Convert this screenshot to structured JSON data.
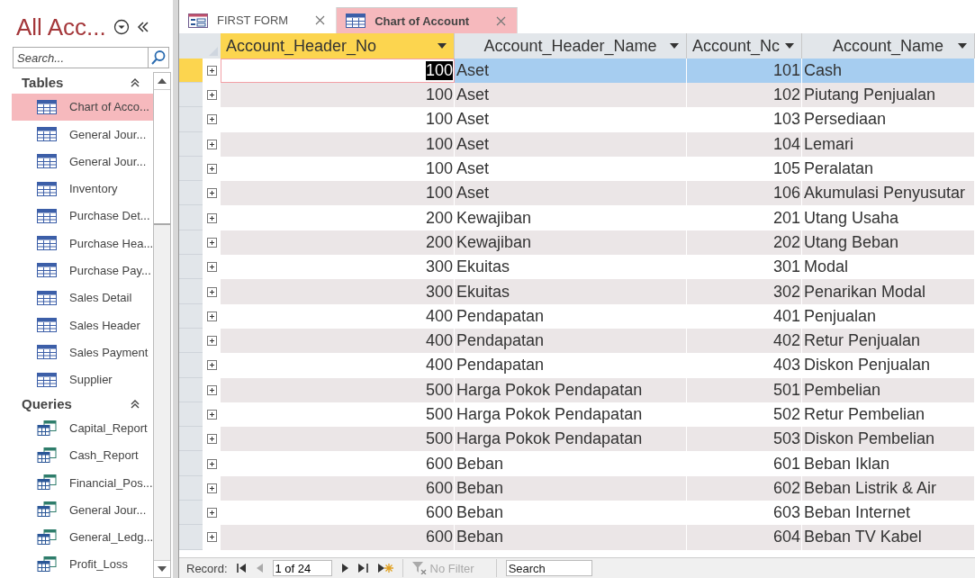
{
  "nav": {
    "title": "All Acc...",
    "search_placeholder": "Search...",
    "groups": [
      {
        "label": "Tables",
        "kind": "table",
        "expanded": true,
        "items": [
          {
            "label": "Chart of Acco...",
            "selected": true
          },
          {
            "label": "General Jour...",
            "selected": false
          },
          {
            "label": "General Jour...",
            "selected": false
          },
          {
            "label": "Inventory",
            "selected": false
          },
          {
            "label": "Purchase Det...",
            "selected": false
          },
          {
            "label": "Purchase Hea...",
            "selected": false
          },
          {
            "label": "Purchase Pay...",
            "selected": false
          },
          {
            "label": "Sales Detail",
            "selected": false
          },
          {
            "label": "Sales Header",
            "selected": false
          },
          {
            "label": "Sales Payment",
            "selected": false
          },
          {
            "label": "Supplier",
            "selected": false
          }
        ]
      },
      {
        "label": "Queries",
        "kind": "query",
        "expanded": true,
        "items": [
          {
            "label": "Capital_Report",
            "selected": false
          },
          {
            "label": "Cash_Report",
            "selected": false
          },
          {
            "label": "Financial_Pos...",
            "selected": false
          },
          {
            "label": "General Jour...",
            "selected": false
          },
          {
            "label": "General_Ledg...",
            "selected": false
          },
          {
            "label": "Profit_Loss",
            "selected": false
          }
        ]
      }
    ]
  },
  "tabs": [
    {
      "label": "FIRST FORM",
      "kind": "form",
      "selected": false
    },
    {
      "label": "Chart of Account",
      "kind": "table",
      "selected": true
    }
  ],
  "table": {
    "columns": [
      {
        "label": "Account_Header_No",
        "selected": true
      },
      {
        "label": "Account_Header_Name",
        "selected": false
      },
      {
        "label": "Account_Nc",
        "selected": false
      },
      {
        "label": "Account_Name",
        "selected": false
      }
    ],
    "rows": [
      {
        "cells": [
          "100",
          "Aset",
          "101",
          "Cash"
        ],
        "selected": true
      },
      {
        "cells": [
          "100",
          "Aset",
          "102",
          "Piutang Penjualan"
        ],
        "selected": false
      },
      {
        "cells": [
          "100",
          "Aset",
          "103",
          "Persediaan"
        ],
        "selected": false
      },
      {
        "cells": [
          "100",
          "Aset",
          "104",
          "Lemari"
        ],
        "selected": false
      },
      {
        "cells": [
          "100",
          "Aset",
          "105",
          "Peralatan"
        ],
        "selected": false
      },
      {
        "cells": [
          "100",
          "Aset",
          "106",
          "Akumulasi Penyusutar"
        ],
        "selected": false
      },
      {
        "cells": [
          "200",
          "Kewajiban",
          "201",
          "Utang Usaha"
        ],
        "selected": false
      },
      {
        "cells": [
          "200",
          "Kewajiban",
          "202",
          "Utang Beban"
        ],
        "selected": false
      },
      {
        "cells": [
          "300",
          "Ekuitas",
          "301",
          "Modal"
        ],
        "selected": false
      },
      {
        "cells": [
          "300",
          "Ekuitas",
          "302",
          "Penarikan Modal"
        ],
        "selected": false
      },
      {
        "cells": [
          "400",
          "Pendapatan",
          "401",
          "Penjualan"
        ],
        "selected": false
      },
      {
        "cells": [
          "400",
          "Pendapatan",
          "402",
          "Retur Penjualan"
        ],
        "selected": false
      },
      {
        "cells": [
          "400",
          "Pendapatan",
          "403",
          "Diskon Penjualan"
        ],
        "selected": false
      },
      {
        "cells": [
          "500",
          "Harga Pokok Pendapatan",
          "501",
          "Pembelian"
        ],
        "selected": false
      },
      {
        "cells": [
          "500",
          "Harga Pokok Pendapatan",
          "502",
          "Retur Pembelian"
        ],
        "selected": false
      },
      {
        "cells": [
          "500",
          "Harga Pokok Pendapatan",
          "503",
          "Diskon Pembelian"
        ],
        "selected": false
      },
      {
        "cells": [
          "600",
          "Beban",
          "601",
          "Beban Iklan"
        ],
        "selected": false
      },
      {
        "cells": [
          "600",
          "Beban",
          "602",
          "Beban Listrik & Air"
        ],
        "selected": false
      },
      {
        "cells": [
          "600",
          "Beban",
          "603",
          "Beban Internet"
        ],
        "selected": false
      },
      {
        "cells": [
          "600",
          "Beban",
          "604",
          "Beban TV Kabel"
        ],
        "selected": false
      }
    ]
  },
  "record_nav": {
    "label": "Record:",
    "position": "1 of 24",
    "filter_label": "No Filter",
    "filter_disabled": true,
    "search_placeholder": "Search"
  }
}
